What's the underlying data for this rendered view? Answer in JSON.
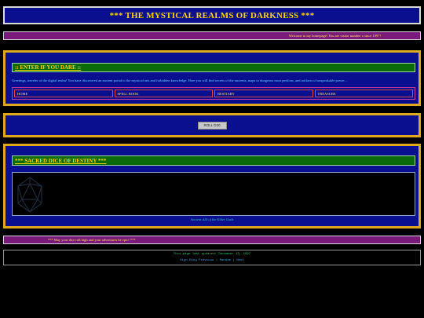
{
  "header": {
    "title": "*** THE MYSTICAL REALMS OF DARKNESS ***"
  },
  "welcome": {
    "text": "Welcome to my homepage! You are visitor number x since 1997!"
  },
  "enter": {
    "heading": ":: ENTER IF YOU DARE ::",
    "greeting": "Greetings, traveler of the digital realm! You have discovered an ancient portal to the mystical arts and forbidden knowledge. Here you will find secrets of the ancients, maps to dungeons most perilous, and artifacts of unspeakable power...",
    "nav": [
      "HOME",
      "SPELL BOOK",
      "BESTIARY",
      "TREASURE"
    ]
  },
  "roll": {
    "button_label": "ROLL D20"
  },
  "dice": {
    "heading": "*** SACRED DICE OF DESTINY ***",
    "caption": "Ancient d20 of the Elder Gods",
    "icon": "d20-icon"
  },
  "footer": {
    "quote": "*** May your dice roll high and your adventures be epic! ***",
    "updated": "This page last updated: December 13, 1997",
    "links": [
      "Sign Ring Previous",
      "Random",
      "Next"
    ]
  },
  "colors": {
    "panel_blue": "#0a0f8f",
    "gold_border": "#e0a81c",
    "heading_green": "#0b6b0b",
    "banner_purple": "#7a1a7a",
    "title_yellow": "#ffd400"
  }
}
